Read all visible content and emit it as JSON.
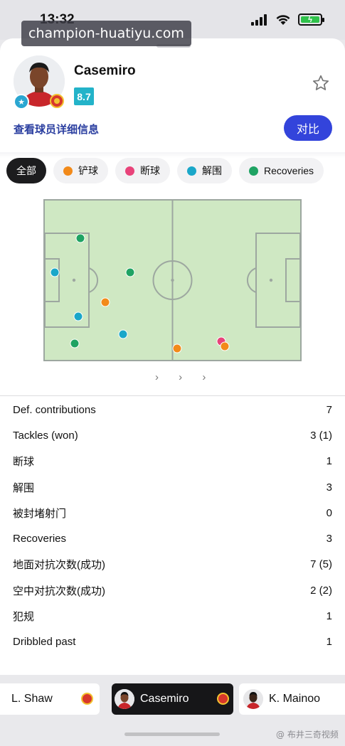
{
  "status": {
    "time": "13:32"
  },
  "watermark": {
    "site": "champion-huatiyu.com",
    "credit": "@ 布井三奇视频"
  },
  "player": {
    "name": "Casemiro",
    "rating": "8.7"
  },
  "actions": {
    "detail_link": "查看球员详细信息",
    "compare_label": "对比"
  },
  "filters": [
    {
      "label": "全部",
      "color": ""
    },
    {
      "label": "铲球",
      "color": "#f28a1a"
    },
    {
      "label": "断球",
      "color": "#e8437a"
    },
    {
      "label": "解围",
      "color": "#1aa7c9"
    },
    {
      "label": "Recoveries",
      "color": "#1fa363"
    }
  ],
  "pitch_events": [
    {
      "type": "Recoveries",
      "color": "#1fa363"
    },
    {
      "type": "解围",
      "color": "#1aa7c9"
    },
    {
      "type": "Recoveries",
      "color": "#1fa363"
    },
    {
      "type": "铲球",
      "color": "#f28a1a"
    },
    {
      "type": "解围",
      "color": "#1aa7c9"
    },
    {
      "type": "解围",
      "color": "#1aa7c9"
    },
    {
      "type": "Recoveries",
      "color": "#1fa363"
    },
    {
      "type": "铲球",
      "color": "#f28a1a"
    },
    {
      "type": "断球",
      "color": "#e8437a"
    },
    {
      "type": "铲球",
      "color": "#f28a1a"
    }
  ],
  "pager": "› › ›",
  "stats": [
    {
      "label": "Def. contributions",
      "value": "7"
    },
    {
      "label": "Tackles (won)",
      "value": "3 (1)"
    },
    {
      "label": "断球",
      "value": "1"
    },
    {
      "label": "解围",
      "value": "3"
    },
    {
      "label": "被封堵射门",
      "value": "0"
    },
    {
      "label": "Recoveries",
      "value": "3"
    },
    {
      "label": "地面对抗次数(成功)",
      "value": "7 (5)"
    },
    {
      "label": "空中对抗次数(成功)",
      "value": "2 (2)"
    },
    {
      "label": "犯规",
      "value": "1"
    },
    {
      "label": "Dribbled past",
      "value": "1"
    }
  ],
  "players_bar": [
    {
      "name": "L. Shaw"
    },
    {
      "name": "Casemiro"
    },
    {
      "name": "K. Mainoo"
    }
  ]
}
